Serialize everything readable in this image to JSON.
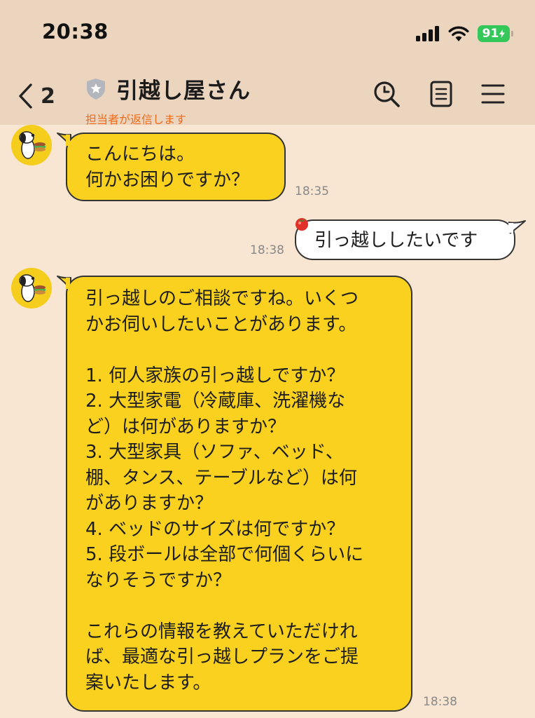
{
  "status_bar": {
    "time": "20:38",
    "battery": "91"
  },
  "header": {
    "back_count": "2",
    "title": "引越し屋さん",
    "subtitle": "担当者が返信します"
  },
  "messages": [
    {
      "side": "in",
      "text": "こんにちは。\n何かお困りですか？",
      "time": "18:35"
    },
    {
      "side": "out",
      "text": "引っ越ししたいです",
      "time": "18:38"
    },
    {
      "side": "in",
      "text": "引っ越しのご相談ですね。いくつ\nかお伺いしたいことがあります。\n\n1. 何人家族の引っ越しですか？\n2. 大型家電（冷蔵庫、洗濯機な\nど）は何がありますか？\n3. 大型家具（ソファ、ベッド、\n棚、タンス、テーブルなど）は何\nがありますか？\n4. ベッドのサイズは何ですか？\n5. 段ボールは全部で何個くらいに\nなりそうですか？\n\nこれらの情報を教えていただけれ\nば、最適な引っ越しプランをご提\n案いたします。",
      "time": "18:38"
    }
  ],
  "icons": {
    "back": "chevron-left-icon",
    "official": "shield-star-icon",
    "search": "search-icon",
    "notes": "note-icon",
    "menu": "menu-icon",
    "avatar": "snoopy-avatar"
  }
}
